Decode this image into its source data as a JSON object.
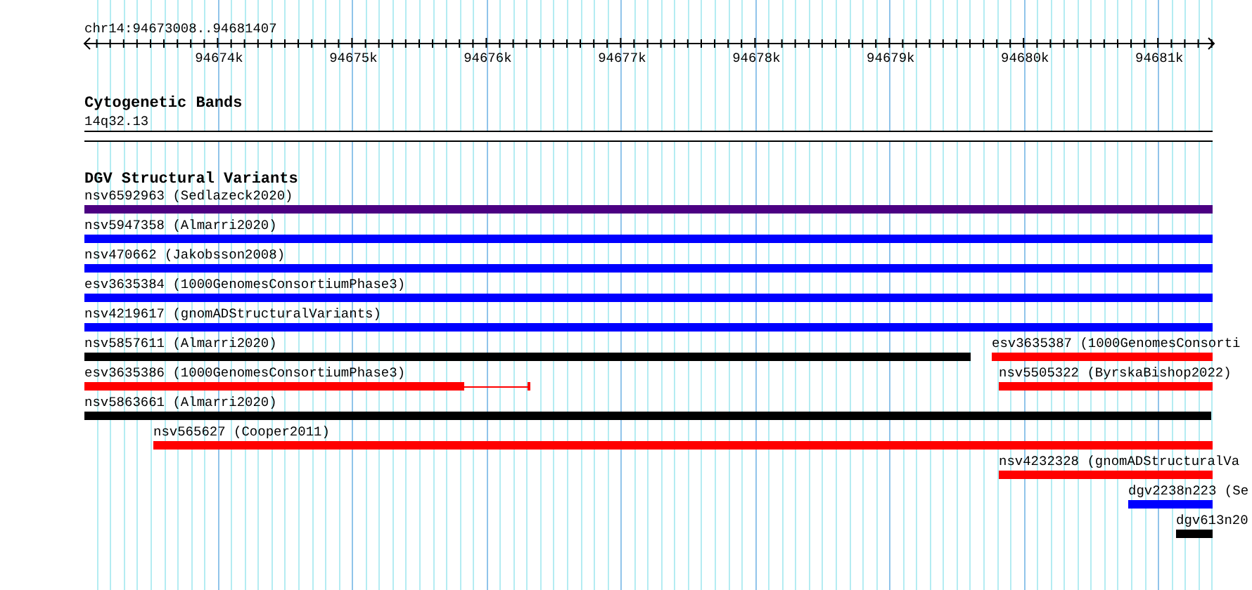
{
  "location": "chr14:94673008..94681407",
  "ruler": {
    "ticks": [
      "94674k",
      "94675k",
      "94676k",
      "94677k",
      "94678k",
      "94679k",
      "94680k",
      "94681k"
    ]
  },
  "tracks": [
    {
      "title": "Cytogenetic Bands",
      "kind": "bands",
      "features": [
        {
          "label": "14q32.13"
        }
      ]
    },
    {
      "title": "DGV Structural Variants",
      "kind": "variants",
      "features": [
        {
          "label": "nsv6592963 (Sedlazeck2020)",
          "color": "#4b0082"
        },
        {
          "label": "nsv5947358 (Almarri2020)",
          "color": "#0000ff"
        },
        {
          "label": "nsv470662 (Jakobsson2008)",
          "color": "#0000ff"
        },
        {
          "label": "esv3635384 (1000GenomesConsortiumPhase3)",
          "color": "#0000ff"
        },
        {
          "label": "nsv4219617 (gnomADStructuralVariants)",
          "color": "#0000ff"
        },
        {
          "label": "nsv5857611 (Almarri2020)",
          "color": "#000000"
        },
        {
          "label": "esv3635387 (1000GenomesConsorti",
          "color": "#ff0000"
        },
        {
          "label": "esv3635386 (1000GenomesConsortiumPhase3)",
          "color": "#ff0000"
        },
        {
          "label": "nsv5505322 (ByrskaBishop2022)",
          "color": "#ff0000"
        },
        {
          "label": "nsv5863661 (Almarri2020)",
          "color": "#000000"
        },
        {
          "label": "nsv565627 (Cooper2011)",
          "color": "#ff0000"
        },
        {
          "label": "nsv4232328 (gnomADStructuralVa",
          "color": "#ff0000"
        },
        {
          "label": "dgv2238n223 (Se",
          "color": "#0000ff"
        },
        {
          "label": "dgv613n20",
          "color": "#000000"
        }
      ]
    }
  ]
}
